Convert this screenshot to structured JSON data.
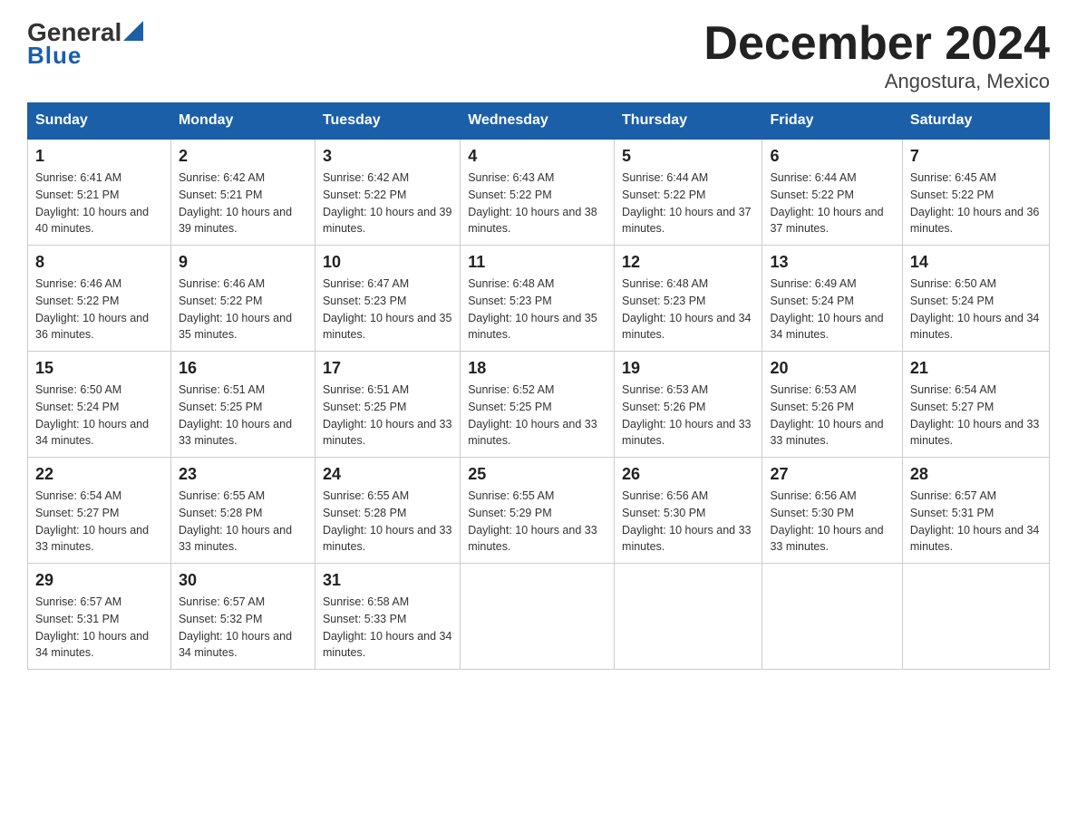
{
  "header": {
    "logo_general": "General",
    "logo_blue": "Blue",
    "title": "December 2024",
    "subtitle": "Angostura, Mexico"
  },
  "weekdays": [
    "Sunday",
    "Monday",
    "Tuesday",
    "Wednesday",
    "Thursday",
    "Friday",
    "Saturday"
  ],
  "weeks": [
    [
      {
        "day": "1",
        "sunrise": "6:41 AM",
        "sunset": "5:21 PM",
        "daylight": "10 hours and 40 minutes."
      },
      {
        "day": "2",
        "sunrise": "6:42 AM",
        "sunset": "5:21 PM",
        "daylight": "10 hours and 39 minutes."
      },
      {
        "day": "3",
        "sunrise": "6:42 AM",
        "sunset": "5:22 PM",
        "daylight": "10 hours and 39 minutes."
      },
      {
        "day": "4",
        "sunrise": "6:43 AM",
        "sunset": "5:22 PM",
        "daylight": "10 hours and 38 minutes."
      },
      {
        "day": "5",
        "sunrise": "6:44 AM",
        "sunset": "5:22 PM",
        "daylight": "10 hours and 37 minutes."
      },
      {
        "day": "6",
        "sunrise": "6:44 AM",
        "sunset": "5:22 PM",
        "daylight": "10 hours and 37 minutes."
      },
      {
        "day": "7",
        "sunrise": "6:45 AM",
        "sunset": "5:22 PM",
        "daylight": "10 hours and 36 minutes."
      }
    ],
    [
      {
        "day": "8",
        "sunrise": "6:46 AM",
        "sunset": "5:22 PM",
        "daylight": "10 hours and 36 minutes."
      },
      {
        "day": "9",
        "sunrise": "6:46 AM",
        "sunset": "5:22 PM",
        "daylight": "10 hours and 35 minutes."
      },
      {
        "day": "10",
        "sunrise": "6:47 AM",
        "sunset": "5:23 PM",
        "daylight": "10 hours and 35 minutes."
      },
      {
        "day": "11",
        "sunrise": "6:48 AM",
        "sunset": "5:23 PM",
        "daylight": "10 hours and 35 minutes."
      },
      {
        "day": "12",
        "sunrise": "6:48 AM",
        "sunset": "5:23 PM",
        "daylight": "10 hours and 34 minutes."
      },
      {
        "day": "13",
        "sunrise": "6:49 AM",
        "sunset": "5:24 PM",
        "daylight": "10 hours and 34 minutes."
      },
      {
        "day": "14",
        "sunrise": "6:50 AM",
        "sunset": "5:24 PM",
        "daylight": "10 hours and 34 minutes."
      }
    ],
    [
      {
        "day": "15",
        "sunrise": "6:50 AM",
        "sunset": "5:24 PM",
        "daylight": "10 hours and 34 minutes."
      },
      {
        "day": "16",
        "sunrise": "6:51 AM",
        "sunset": "5:25 PM",
        "daylight": "10 hours and 33 minutes."
      },
      {
        "day": "17",
        "sunrise": "6:51 AM",
        "sunset": "5:25 PM",
        "daylight": "10 hours and 33 minutes."
      },
      {
        "day": "18",
        "sunrise": "6:52 AM",
        "sunset": "5:25 PM",
        "daylight": "10 hours and 33 minutes."
      },
      {
        "day": "19",
        "sunrise": "6:53 AM",
        "sunset": "5:26 PM",
        "daylight": "10 hours and 33 minutes."
      },
      {
        "day": "20",
        "sunrise": "6:53 AM",
        "sunset": "5:26 PM",
        "daylight": "10 hours and 33 minutes."
      },
      {
        "day": "21",
        "sunrise": "6:54 AM",
        "sunset": "5:27 PM",
        "daylight": "10 hours and 33 minutes."
      }
    ],
    [
      {
        "day": "22",
        "sunrise": "6:54 AM",
        "sunset": "5:27 PM",
        "daylight": "10 hours and 33 minutes."
      },
      {
        "day": "23",
        "sunrise": "6:55 AM",
        "sunset": "5:28 PM",
        "daylight": "10 hours and 33 minutes."
      },
      {
        "day": "24",
        "sunrise": "6:55 AM",
        "sunset": "5:28 PM",
        "daylight": "10 hours and 33 minutes."
      },
      {
        "day": "25",
        "sunrise": "6:55 AM",
        "sunset": "5:29 PM",
        "daylight": "10 hours and 33 minutes."
      },
      {
        "day": "26",
        "sunrise": "6:56 AM",
        "sunset": "5:30 PM",
        "daylight": "10 hours and 33 minutes."
      },
      {
        "day": "27",
        "sunrise": "6:56 AM",
        "sunset": "5:30 PM",
        "daylight": "10 hours and 33 minutes."
      },
      {
        "day": "28",
        "sunrise": "6:57 AM",
        "sunset": "5:31 PM",
        "daylight": "10 hours and 34 minutes."
      }
    ],
    [
      {
        "day": "29",
        "sunrise": "6:57 AM",
        "sunset": "5:31 PM",
        "daylight": "10 hours and 34 minutes."
      },
      {
        "day": "30",
        "sunrise": "6:57 AM",
        "sunset": "5:32 PM",
        "daylight": "10 hours and 34 minutes."
      },
      {
        "day": "31",
        "sunrise": "6:58 AM",
        "sunset": "5:33 PM",
        "daylight": "10 hours and 34 minutes."
      },
      null,
      null,
      null,
      null
    ]
  ]
}
